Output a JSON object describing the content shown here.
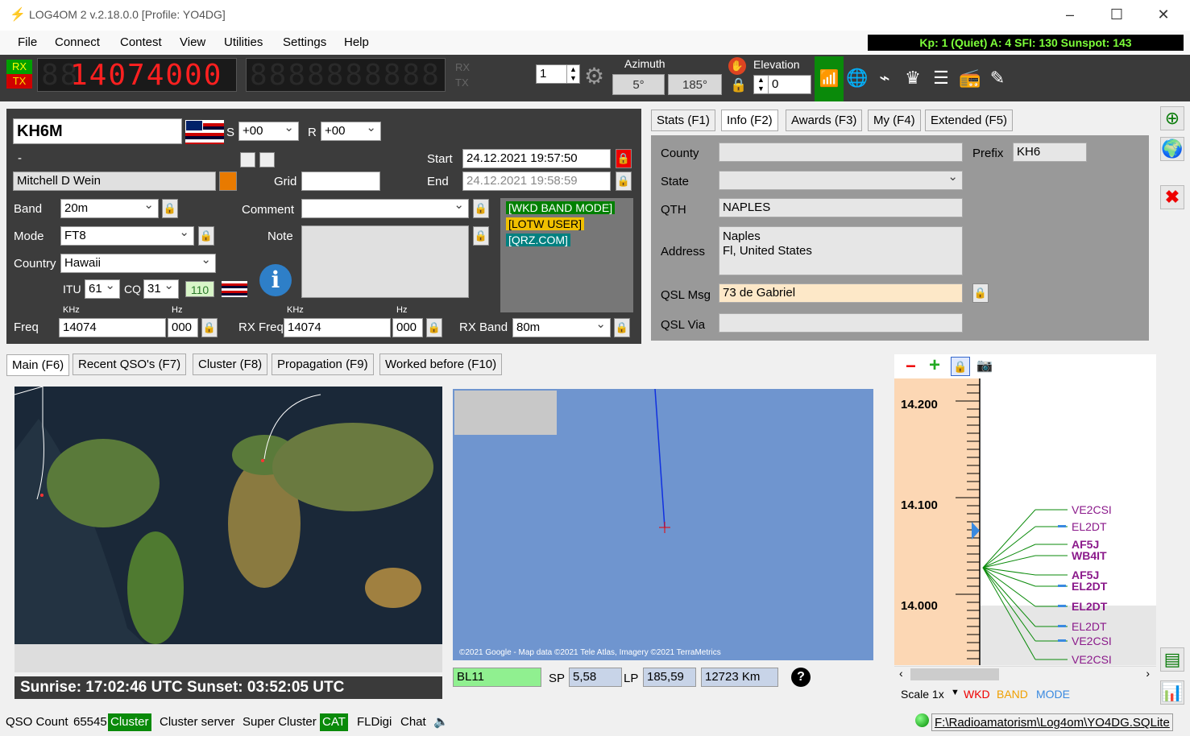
{
  "app": {
    "title": "LOG4OM 2 v.2.18.0.0 [Profile: YO4DG]"
  },
  "menu": [
    "File",
    "Connect",
    "Contest",
    "View",
    "Utilities",
    "Settings",
    "Help"
  ],
  "solar": "Kp: 1 (Quiet)  A: 4  SFI: 130 Sunspot: 143",
  "radio": {
    "rx_label": "RX",
    "tx_label": "TX",
    "frequency_display": "14074000",
    "sub_display": "8888888888",
    "rx_small": "RX",
    "tx_small": "TX",
    "spin_value": "1"
  },
  "rotator": {
    "azimuth_label": "Azimuth",
    "azimuth_sp": "5°",
    "azimuth_lp": "185°",
    "elevation_label": "Elevation",
    "elevation_value": "0"
  },
  "colors": {
    "accent_green": "#00a000",
    "tx_red": "#d00000",
    "solar_text": "#7dff3a"
  },
  "qso": {
    "callsign": "KH6M",
    "s_label": "S",
    "s_value": "+00",
    "r_label": "R",
    "r_value": "+00",
    "dash": "-",
    "name": "Mitchell D Wein",
    "start_label": "Start",
    "start_value": "24.12.2021 19:57:50",
    "end_label": "End",
    "end_value": "24.12.2021 19:58:59",
    "grid_label": "Grid",
    "grid_value": "",
    "band_label": "Band",
    "band_value": "20m",
    "mode_label": "Mode",
    "mode_value": "FT8",
    "country_label": "Country",
    "country_value": "Hawaii",
    "itu_label": "ITU",
    "itu_value": "61",
    "cq_label": "CQ",
    "cq_value": "31",
    "dxcc_value": "110",
    "comment_label": "Comment",
    "comment_value": "",
    "note_label": "Note",
    "tags": [
      "[WKD BAND MODE]",
      "[LOTW USER]",
      "[QRZ.COM]"
    ],
    "khz_label": "KHz",
    "hz_label": "Hz",
    "freq_label": "Freq",
    "freq_khz": "14074",
    "freq_hz": "000",
    "rxfreq_label": "RX Freq",
    "rxfreq_khz": "14074",
    "rxfreq_hz": "000",
    "rxband_label": "RX Band",
    "rxband_value": "80m"
  },
  "info_tabs": [
    "Stats (F1)",
    "Info (F2)",
    "Awards (F3)",
    "My (F4)",
    "Extended (F5)"
  ],
  "info": {
    "county_label": "County",
    "county_value": "",
    "prefix_label": "Prefix",
    "prefix_value": "KH6",
    "state_label": "State",
    "state_value": "",
    "qth_label": "QTH",
    "qth_value": "NAPLES",
    "address_label": "Address",
    "address_line1": "Naples",
    "address_line2": "Fl, United States",
    "qslmsg_label": "QSL Msg",
    "qslmsg_value": "73 de Gabriel",
    "qslvia_label": "QSL Via",
    "qslvia_value": ""
  },
  "main_tabs": [
    "Main (F6)",
    "Recent QSO's (F7)",
    "Cluster (F8)",
    "Propagation (F9)",
    "Worked before (F10)"
  ],
  "sun": "Sunrise: 17:02:46 UTC  Sunset: 03:52:05 UTC",
  "map": {
    "copyright": "©2021 Google - Map data ©2021 Tele Atlas, Imagery ©2021 TerraMetrics",
    "locator": "BL11",
    "sp_label": "SP",
    "sp_value": "5,58",
    "lp_label": "LP",
    "lp_value": "185,59",
    "distance": "12723 Km"
  },
  "bandmap": {
    "ticks": [
      "14.200",
      "14.100",
      "14.000"
    ],
    "spots": [
      {
        "call": "VE2CSI",
        "color": "#8b1a8b",
        "bold": false
      },
      {
        "call": "EL2DT",
        "color": "#8b1a8b",
        "bold": false
      },
      {
        "call": "AF5J",
        "color": "#8b1a8b",
        "bold": true
      },
      {
        "call": "WB4IT",
        "color": "#8b1a8b",
        "bold": true
      },
      {
        "call": "AF5J",
        "color": "#8b1a8b",
        "bold": true
      },
      {
        "call": "EL2DT",
        "color": "#8b1a8b",
        "bold": true
      },
      {
        "call": "EL2DT",
        "color": "#8b1a8b",
        "bold": true
      },
      {
        "call": "EL2DT",
        "color": "#8b1a8b",
        "bold": false
      },
      {
        "call": "VE2CSI",
        "color": "#8b1a8b",
        "bold": false
      },
      {
        "call": "VE2CSI",
        "color": "#8b1a8b",
        "bold": false
      }
    ],
    "scale": "Scale 1x",
    "wkd": "WKD",
    "band": "BAND",
    "mode": "MODE"
  },
  "status": {
    "qso_count_label": "QSO Count",
    "qso_count": "65545",
    "cluster": "Cluster",
    "cluster_server": "Cluster server",
    "super_cluster": "Super Cluster",
    "cat": "CAT",
    "fldigi": "FLDigi",
    "chat": "Chat",
    "db_path": "F:\\Radioamatorism\\Log4om\\YO4DG.SQLite"
  }
}
